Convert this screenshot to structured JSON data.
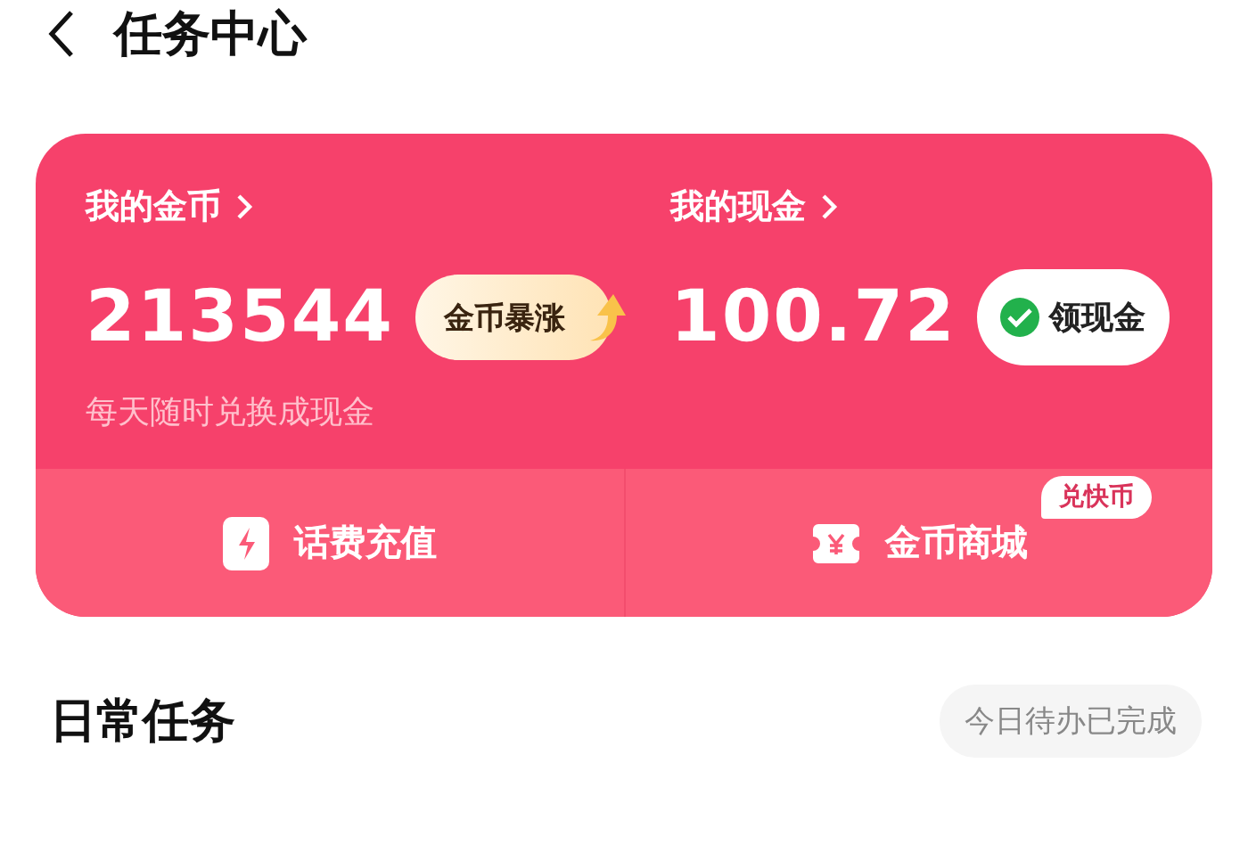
{
  "header": {
    "title": "任务中心"
  },
  "wallet": {
    "coins": {
      "label": "我的金币",
      "value": "213544",
      "badge": "金币暴涨",
      "note": "每天随时兑换成现金"
    },
    "cash": {
      "label": "我的现金",
      "value": "100.72",
      "button": "领现金"
    }
  },
  "shortcuts": [
    {
      "kind": "phone",
      "label": "话费充值"
    },
    {
      "kind": "mall",
      "label": "金币商城",
      "tag": "兑快币"
    }
  ],
  "daily": {
    "title": "日常任务",
    "status": "今日待办已完成"
  }
}
